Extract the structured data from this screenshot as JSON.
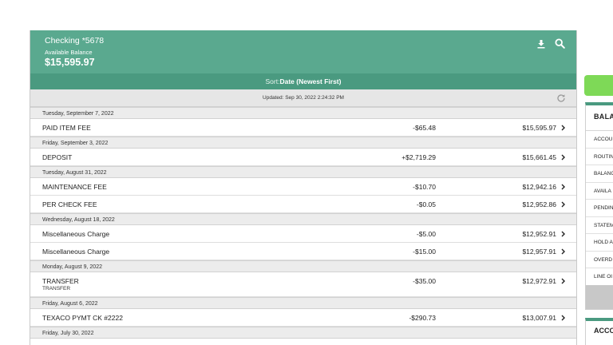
{
  "account": {
    "name": "Checking *5678",
    "available_label": "Available Balance",
    "balance": "$15,595.97"
  },
  "icons": {
    "download": "download-icon",
    "search": "search-icon",
    "refresh": "refresh-icon",
    "chevron": "chevron-right-icon"
  },
  "sort": {
    "label": "Sort:",
    "value": "Date (Newest First)"
  },
  "updated": "Updated: Sep 30, 2022 2:24:32 PM",
  "dates": [
    "Tuesday, September 7, 2022",
    "Friday, September 3, 2022",
    "Tuesday, August 31, 2022",
    "Wednesday, August 18, 2022",
    "Monday, August 9, 2022",
    "Friday, August 6, 2022",
    "Friday, July 30, 2022"
  ],
  "transactions": [
    {
      "desc": "PAID ITEM FEE",
      "amount": "-$65.48",
      "balance": "$15,595.97"
    },
    {
      "desc": "DEPOSIT",
      "amount": "+$2,719.29",
      "balance": "$15,661.45"
    },
    {
      "desc": "MAINTENANCE FEE",
      "amount": "-$10.70",
      "balance": "$12,942.16"
    },
    {
      "desc": "PER CHECK FEE",
      "amount": "-$0.05",
      "balance": "$12,952.86"
    },
    {
      "desc": "Miscellaneous Charge",
      "amount": "-$5.00",
      "balance": "$12,952.91"
    },
    {
      "desc": "Miscellaneous Charge",
      "amount": "-$15.00",
      "balance": "$12,957.91"
    },
    {
      "desc": "TRANSFER",
      "sub": "TRANSFER",
      "amount": "-$35.00",
      "balance": "$12,972.91"
    },
    {
      "desc": "TEXACO PYMT CK #2222",
      "amount": "-$290.73",
      "balance": "$13,007.91"
    }
  ],
  "side": {
    "title": "BALA",
    "rows": [
      "ACCOU",
      "ROUTIN",
      "BALANG",
      "AVAILA",
      "PENDIN",
      "STATEM",
      "HOLD A",
      "OVERD",
      "LINE OI"
    ],
    "title2": "ACCO"
  },
  "colors": {
    "header": "#5aa98f",
    "sort_bar": "#4a9a80",
    "side_button": "#7ed957"
  }
}
